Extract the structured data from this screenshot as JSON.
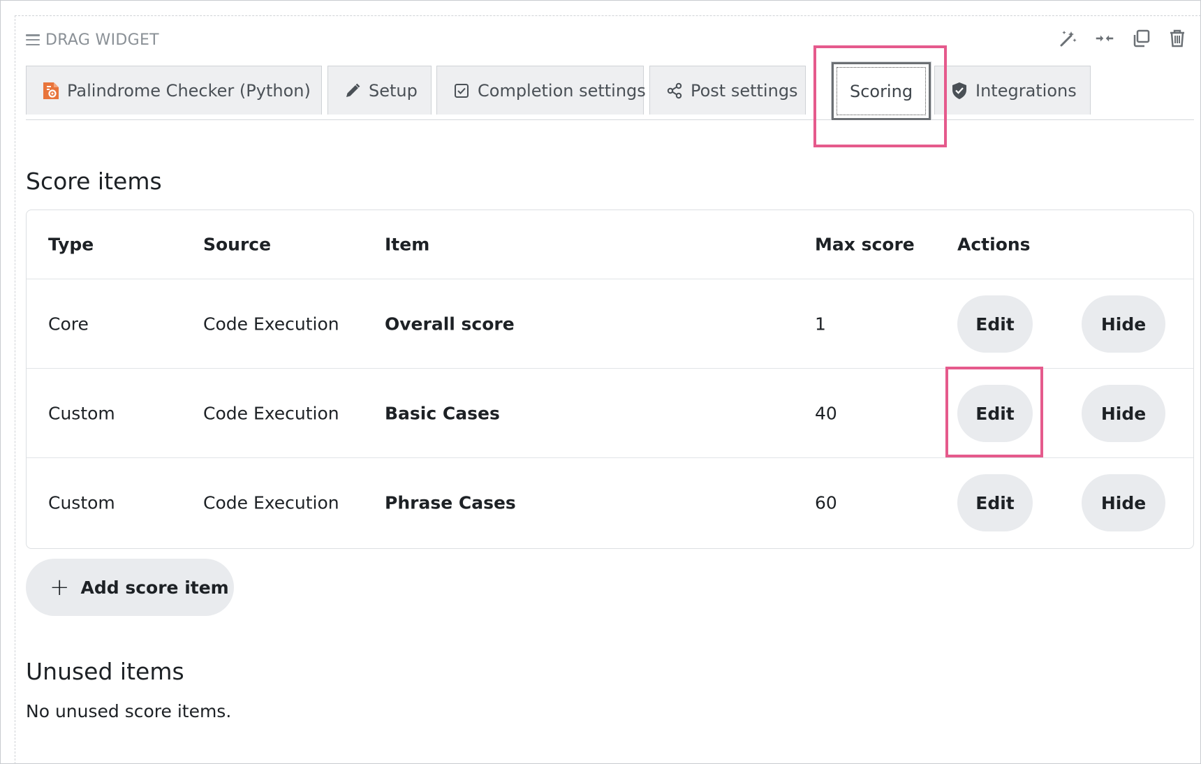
{
  "widget": {
    "drag_label": "DRAG WIDGET",
    "tools": [
      {
        "icon": "magic-wand-icon"
      },
      {
        "icon": "collapse-arrows-icon"
      },
      {
        "icon": "duplicate-icon"
      },
      {
        "icon": "trash-icon"
      }
    ]
  },
  "tabs": [
    {
      "label": "Palindrome Checker (Python)",
      "icon": "code-execution-icon"
    },
    {
      "label": "Setup",
      "icon": "pencil-icon"
    },
    {
      "label": "Completion settings",
      "icon": "checkbox-icon"
    },
    {
      "label": "Post settings",
      "icon": "share-icon"
    },
    {
      "label": "Scoring",
      "active": true
    },
    {
      "label": "Integrations",
      "icon": "shield-icon"
    }
  ],
  "score_items": {
    "heading": "Score items",
    "columns": [
      "Type",
      "Source",
      "Item",
      "Max score",
      "Actions"
    ],
    "rows": [
      {
        "type": "Core",
        "source": "Code Execution",
        "item": "Overall score",
        "max": "1",
        "edit": "Edit",
        "hide": "Hide"
      },
      {
        "type": "Custom",
        "source": "Code Execution",
        "item": "Basic Cases",
        "max": "40",
        "edit": "Edit",
        "hide": "Hide"
      },
      {
        "type": "Custom",
        "source": "Code Execution",
        "item": "Phrase Cases",
        "max": "60",
        "edit": "Edit",
        "hide": "Hide"
      }
    ],
    "add_label": "Add score item"
  },
  "unused": {
    "heading": "Unused items",
    "empty_text": "No unused score items."
  },
  "colors": {
    "highlight": "#e55a8c",
    "pill_bg": "#e9ebee",
    "tab_bg": "#eeeff1",
    "icon_orange": "#e8743b"
  }
}
